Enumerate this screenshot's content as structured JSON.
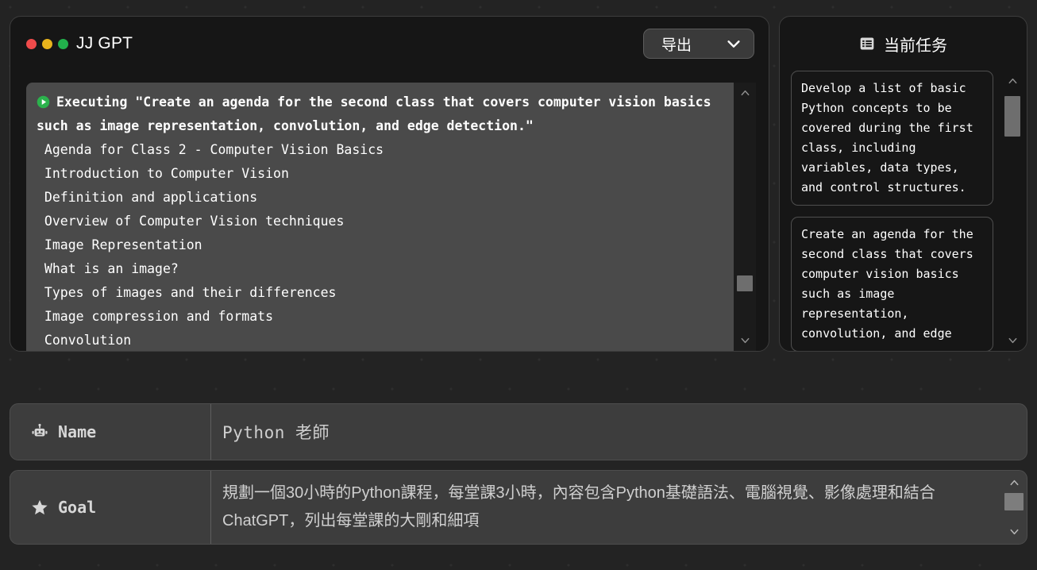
{
  "window": {
    "title": "JJ GPT",
    "traffic_lights": [
      "close-red",
      "minimize-yellow",
      "maximize-green"
    ],
    "export_button": {
      "label": "导出",
      "icon": "chevron-down-icon"
    }
  },
  "console": {
    "executing_line": "Executing \"Create an agenda for the second class that covers computer vision basics such as image representation, convolution, and edge detection.\"",
    "run_icon": "play-circle-icon",
    "lines": [
      " Agenda for Class 2 - Computer Vision Basics",
      " Introduction to Computer Vision",
      " Definition and applications",
      " Overview of Computer Vision techniques",
      " Image Representation",
      " What is an image?",
      " Types of images and their differences",
      " Image compression and formats",
      " Convolution"
    ],
    "scrollbar": {
      "up_icon": "chevron-up-icon",
      "down_icon": "chevron-down-icon",
      "thumb_top_pct": 76,
      "thumb_height_pct": 7
    }
  },
  "task_panel": {
    "header": {
      "icon": "list-view-icon",
      "title": "当前任务"
    },
    "tasks": [
      "Develop a list of basic Python concepts to be covered during the first class, including variables, data types, and control structures.",
      "Create an agenda for the second class that covers computer vision basics such as image representation, convolution, and edge"
    ],
    "scrollbar": {
      "up_icon": "chevron-up-icon",
      "down_icon": "chevron-down-icon",
      "thumb_top_pct": 2,
      "thumb_height_pct": 17
    }
  },
  "fields": {
    "name": {
      "icon": "robot-icon",
      "label": "Name",
      "value": "Python 老師"
    },
    "goal": {
      "icon": "star-icon",
      "label": "Goal",
      "value": "規劃一個30小時的Python課程，每堂課3小時，內容包含Python基礎語法、電腦視覺、影像處理和結合ChatGPT，列出每堂課的大剛和細項",
      "scrollbar": {
        "up_icon": "chevron-up-icon",
        "down_icon": "chevron-down-icon",
        "thumb_top_pct": 0,
        "thumb_height_pct": 60
      }
    }
  },
  "colors": {
    "background": "#232323",
    "panel": "#161616",
    "console_bg": "#4a4a4a",
    "field_bg": "#3d3d3d",
    "accent_green": "#22b14c",
    "text": "#ffffff"
  }
}
